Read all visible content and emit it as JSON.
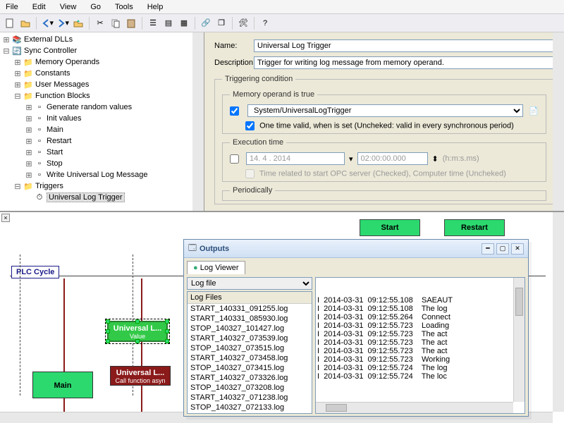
{
  "menu": [
    "File",
    "Edit",
    "View",
    "Go",
    "Tools",
    "Help"
  ],
  "tree": {
    "root1": "External DLLs",
    "root2": "Sync Controller",
    "c1": "Memory Operands",
    "c2": "Constants",
    "c3": "User Messages",
    "c4": "Function Blocks",
    "fb": [
      "Generate random values",
      "Init values",
      "Main",
      "Restart",
      "Start",
      "Stop",
      "Write Universal Log Message"
    ],
    "c5": "Triggers",
    "trig": "Universal Log Trigger"
  },
  "props": {
    "name_label": "Name:",
    "name_value": "Universal Log Trigger",
    "desc_label": "Description:",
    "desc_value": "Trigger for writing log message from memory operand.",
    "fs_trig": "Triggering condition",
    "fs_mem": "Memory operand is true",
    "mem_select": "System/UniversalLogTrigger",
    "onetime": "One time valid, when is set (Uncheked: valid in every synchronous period)",
    "fs_exec": "Execution time",
    "date": "14. 4 . 2014",
    "time": "02:00:00.000",
    "hms": "(h:m:s.ms)",
    "timerel": "Time related to start OPC server (Checked), Computer time (Uncheked)",
    "fs_per": "Periodically"
  },
  "canvas": {
    "start": "Start",
    "restart": "Restart",
    "plc": "PLC Cycle",
    "main": "Main",
    "ul1_t": "Universal L...",
    "ul1_s": "Value",
    "ul2_t": "Universal L...",
    "ul2_s": "Call function asyn"
  },
  "outputs": {
    "title": "Outputs",
    "tab": "Log Viewer",
    "combo": "Log file",
    "list_hdr": "Log Files",
    "files": [
      "START_140331_091255.log",
      "START_140331_085930.log",
      "STOP_140327_101427.log",
      "START_140327_073539.log",
      "STOP_140327_073515.log",
      "START_140327_073458.log",
      "STOP_140327_073415.log",
      "START_140327_073326.log",
      "STOP_140327_073208.log",
      "START_140327_071238.log",
      "STOP_140327_072133.log"
    ],
    "lines": [
      "I  2014-03-31  09:12:55.108    SAEAUT",
      "I  2014-03-31  09:12:55.108    The log",
      "I  2014-03-31  09:12:55.264    Connect",
      "I  2014-03-31  09:12:55.723    Loading",
      "I  2014-03-31  09:12:55.723    The act",
      "I  2014-03-31  09:12:55.723    The act",
      "I  2014-03-31  09:12:55.723    The act",
      "I  2014-03-31  09:12:55.723    Working",
      "I  2014-03-31  09:12:55.724    The log",
      "I  2014-03-31  09:12:55.724    The loc"
    ]
  }
}
